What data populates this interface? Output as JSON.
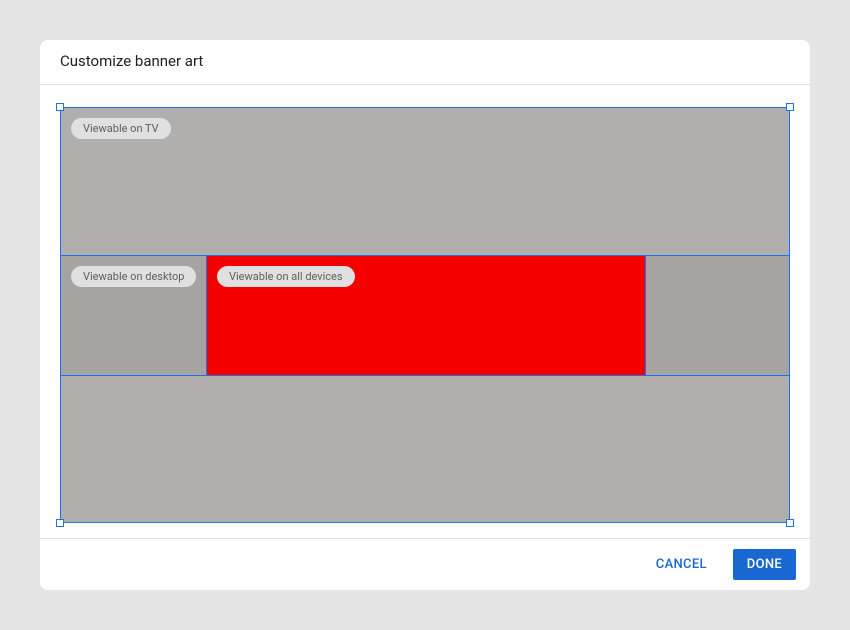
{
  "dialog": {
    "title": "Customize banner art"
  },
  "zones": {
    "tv": "Viewable on TV",
    "desktop": "Viewable on desktop",
    "all": "Viewable on all devices"
  },
  "colors": {
    "accent": "#1a73e8",
    "allDevicesBg": "#f40000",
    "tvBg": "#b1aeae",
    "desktopBg": "#a6a3a3"
  },
  "actions": {
    "cancel": "CANCEL",
    "done": "DONE"
  }
}
